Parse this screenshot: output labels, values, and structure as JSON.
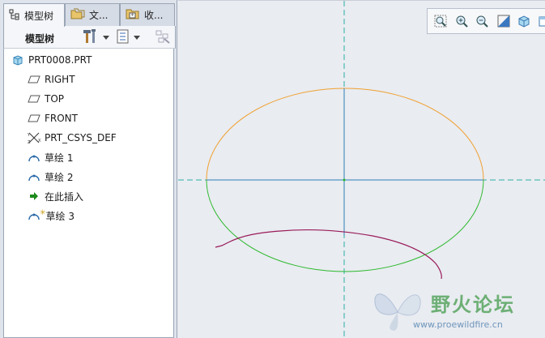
{
  "tabs": [
    {
      "label": "模型树",
      "icon": "model-tree-icon",
      "active": true
    },
    {
      "label": "文...",
      "icon": "folder-icon",
      "active": false
    },
    {
      "label": "收...",
      "icon": "favorites-icon",
      "active": false
    }
  ],
  "tree_toolbar": {
    "title": "模型树",
    "settings_icon": "hammer-icon",
    "show_icon": "list-icon",
    "filter_icon": "filter-icon"
  },
  "tree": {
    "root": {
      "label": "PRT0008.PRT",
      "icon": "part-icon"
    },
    "items": [
      {
        "label": "RIGHT",
        "icon": "datum-plane-icon"
      },
      {
        "label": "TOP",
        "icon": "datum-plane-icon"
      },
      {
        "label": "FRONT",
        "icon": "datum-plane-icon"
      },
      {
        "label": "PRT_CSYS_DEF",
        "icon": "coordinate-system-icon"
      },
      {
        "label": "草绘 1",
        "icon": "sketch-icon"
      },
      {
        "label": "草绘 2",
        "icon": "sketch-icon"
      },
      {
        "label": "在此插入",
        "icon": "insert-here-arrow-icon"
      },
      {
        "label": "草绘 3",
        "icon": "sketch-icon-starred"
      }
    ]
  },
  "view_toolbar": [
    {
      "icon": "zoom-window-icon"
    },
    {
      "icon": "zoom-in-icon"
    },
    {
      "icon": "zoom-out-icon"
    },
    {
      "icon": "refit-icon"
    },
    {
      "icon": "shaded-cube-icon"
    },
    {
      "icon": "saved-views-icon"
    }
  ],
  "colors": {
    "ellipse_top": "#f0a030",
    "ellipse_bottom": "#2ab82a",
    "center_line": "#2a7fb8",
    "curve": "#9a1b5a",
    "dash_axis": "#2ab0a8"
  },
  "watermark": {
    "title": "野火论坛",
    "url": "www.proewildfire.cn"
  }
}
